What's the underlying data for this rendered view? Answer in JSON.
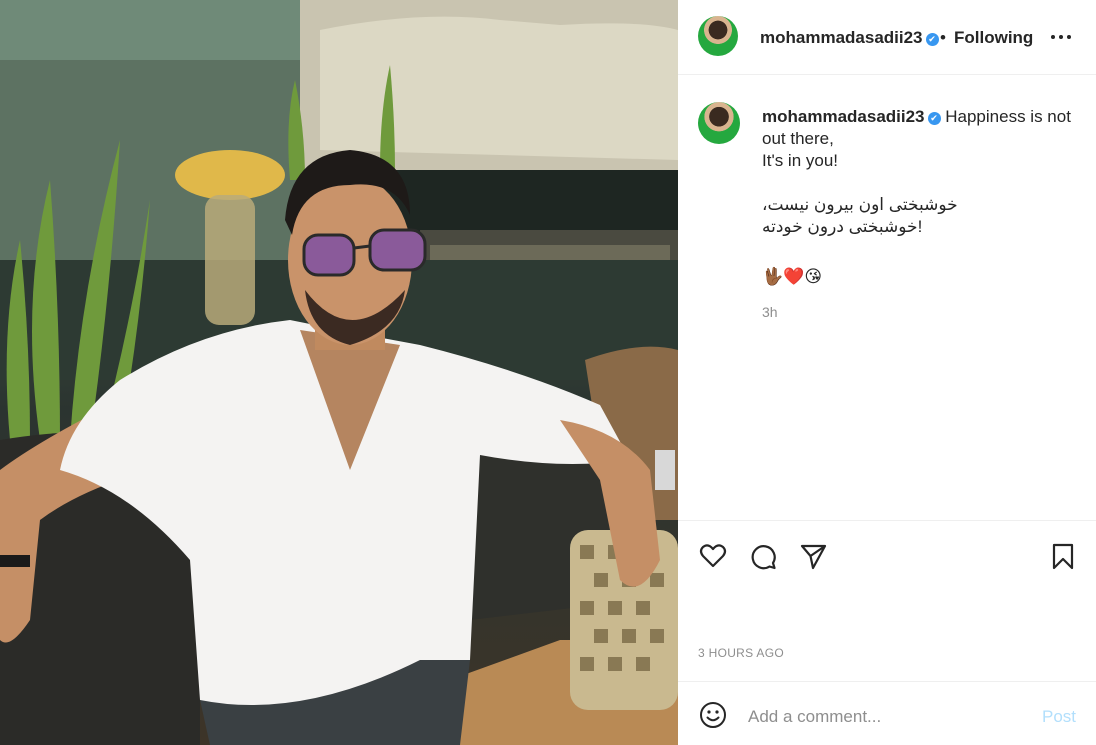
{
  "post": {
    "username": "mohammadasadii23",
    "verified_mark": "✔",
    "separator": "•",
    "follow_status": "Following",
    "more_label": "•••"
  },
  "caption": {
    "username": "mohammadasadii23",
    "line1": "Happiness is not out there,",
    "line2": "It's in you!",
    "fa_line1": "خوشبختی اون بیرون نیست،",
    "fa_line2": "!خوشبختی درون خودته",
    "emojis": "🖖🏾❤️😘",
    "relative_time": "3h"
  },
  "actions": {
    "icons": [
      "heart-icon",
      "comment-icon",
      "share-icon",
      "bookmark-icon"
    ]
  },
  "timestamp": "3 HOURS AGO",
  "comment_box": {
    "placeholder": "Add a comment...",
    "post_label": "Post"
  },
  "colors": {
    "verified": "#3897f0",
    "post_disabled": "#b2dffc",
    "muted": "#8e8e8e",
    "text": "#262626"
  }
}
